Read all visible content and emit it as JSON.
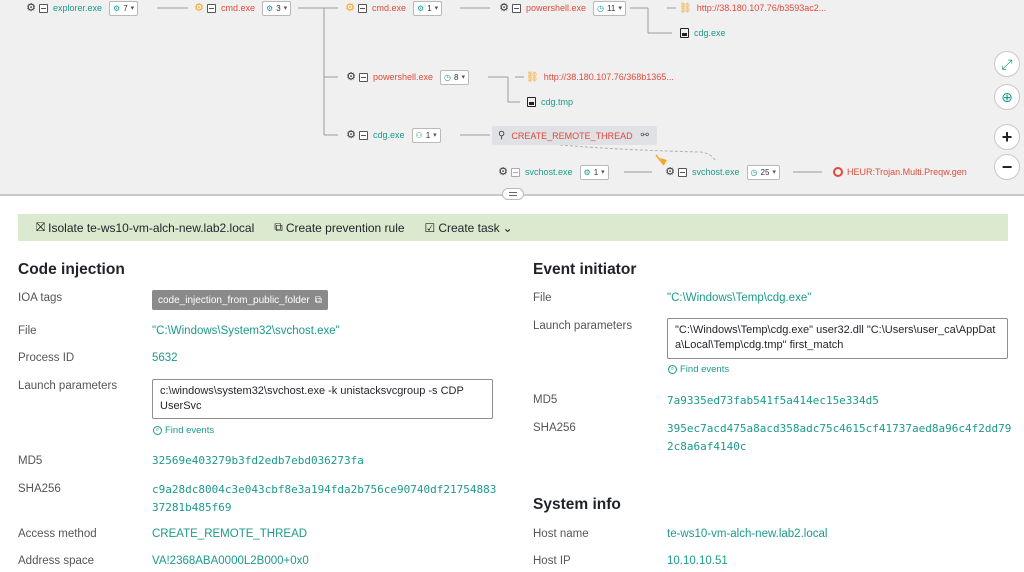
{
  "graph": {
    "nodes": {
      "explorer": {
        "name": "explorer.exe",
        "count": "7"
      },
      "cmd1": {
        "name": "cmd.exe",
        "count": "3"
      },
      "cmd2": {
        "name": "cmd.exe",
        "count": "1"
      },
      "powershell1": {
        "name": "powershell.exe",
        "count": "11"
      },
      "url1": {
        "text": "http://38.180.107.76/b3593ac2..."
      },
      "cdg_exe": {
        "name": "cdg.exe"
      },
      "powershell2": {
        "name": "powershell.exe",
        "count": "8"
      },
      "url2": {
        "text": "http://38.180.107.76/368b1365..."
      },
      "cdg_tmp": {
        "name": "cdg.tmp"
      },
      "cdg": {
        "name": "cdg.exe",
        "count": "1"
      },
      "crt": {
        "label": "CREATE_REMOTE_THREAD"
      },
      "svchost1": {
        "name": "svchost.exe",
        "count": "1"
      },
      "svchost2": {
        "name": "svchost.exe",
        "count": "25"
      },
      "detect": {
        "label": "HEUR:Trojan.Multi.Preqw.gen"
      }
    },
    "icons": {
      "process": "gear-icon",
      "collapse": "collapse-icon",
      "url": "link-icon",
      "file": "file-icon",
      "detection": "alert-icon"
    },
    "zoom_controls": [
      "fit-icon",
      "target-icon",
      "zoom-in-icon",
      "zoom-out-icon"
    ]
  },
  "toolbar": {
    "isolate_label": "Isolate te-ws10-vm-alch-new.lab2.local",
    "prevention_label": "Create prevention rule",
    "task_label": "Create task"
  },
  "left": {
    "title": "Code injection",
    "ioa_label": "IOA tags",
    "ioa_tag": "code_injection_from_public_folder",
    "file_label": "File",
    "file_value": "\"C:\\Windows\\System32\\svchost.exe\"",
    "pid_label": "Process ID",
    "pid_value": "5632",
    "launch_label": "Launch parameters",
    "launch_value": "c:\\windows\\system32\\svchost.exe -k unistacksvcgroup -s CDP UserSvc",
    "find_events": "Find events",
    "md5_label": "MD5",
    "md5_value": "32569e403279b3fd2edb7ebd036273fa",
    "sha_label": "SHA256",
    "sha_value": "c9a28dc8004c3e043cbf8e3a194fda2b756ce90740df2175488337281b485f69",
    "access_label": "Access method",
    "access_value": "CREATE_REMOTE_THREAD",
    "addr_label": "Address space",
    "addr_value": "VA!2368ABA0000L2B000+0x0"
  },
  "right": {
    "title": "Event initiator",
    "file_label": "File",
    "file_value": "\"C:\\Windows\\Temp\\cdg.exe\"",
    "launch_label": "Launch parameters",
    "launch_value": "\"C:\\Windows\\Temp\\cdg.exe\"  user32.dll \"C:\\Users\\user_ca\\AppData\\Local\\Temp\\cdg.tmp\" first_match",
    "find_events": "Find events",
    "md5_label": "MD5",
    "md5_value": "7a9335ed73fab541f5a414ec15e334d5",
    "sha_label": "SHA256",
    "sha_value": "395ec7acd475a8acd358adc75c4615cf41737aed8a96c4f2dd792c8a6af4140c",
    "sys_title": "System info",
    "host_label": "Host name",
    "host_value": "te-ws10-vm-alch-new.lab2.local",
    "ip_label": "Host IP",
    "ip_value": "10.10.10.51"
  },
  "colors": {
    "accent": "#1b9a8a",
    "danger": "#e0493b",
    "toolbar_bg": "#dbe9cf",
    "graph_bg": "#f0f0f0"
  }
}
